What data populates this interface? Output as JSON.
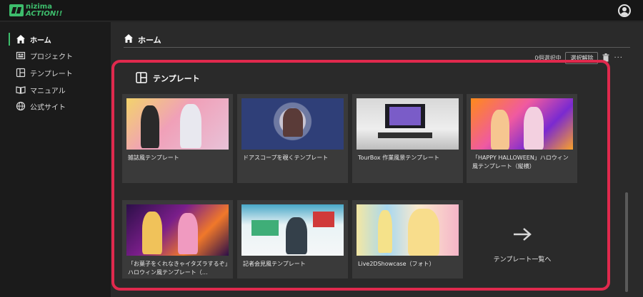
{
  "app": {
    "logo_line1": "nizima",
    "logo_line2": "ACTION!!"
  },
  "sidebar": {
    "items": [
      {
        "label": "ホーム",
        "icon": "home-icon",
        "active": true
      },
      {
        "label": "プロジェクト",
        "icon": "project-icon",
        "active": false
      },
      {
        "label": "テンプレート",
        "icon": "template-icon",
        "active": false
      },
      {
        "label": "マニュアル",
        "icon": "manual-icon",
        "active": false
      },
      {
        "label": "公式サイト",
        "icon": "globe-icon",
        "active": false
      }
    ]
  },
  "header": {
    "title": "ホーム"
  },
  "toolbar": {
    "selected_count": "0個選択中",
    "clear_label": "選択解除",
    "more": "···"
  },
  "templates": {
    "title": "テンプレート",
    "cards": [
      {
        "caption": "雑誌風テンプレート"
      },
      {
        "caption": "ドアスコープを覗くテンプレート"
      },
      {
        "caption": "TourBox 作業風景テンプレート"
      },
      {
        "caption": "「HAPPY HALLOWEEN」ハロウィン風テンプレート（縦横）"
      },
      {
        "caption": "「お菓子をくれなきゃイタズラするぞ」ハロウィン風テンプレート（…"
      },
      {
        "caption": "記者会見風テンプレート"
      },
      {
        "caption": "Live2DShowcase（フォト）"
      }
    ],
    "more_label": "テンプレート一覧へ"
  },
  "colors": {
    "accent": "#3dbd6c",
    "highlight": "#e0294d",
    "background": "#2a2a2a",
    "card": "#3a3a3a"
  }
}
